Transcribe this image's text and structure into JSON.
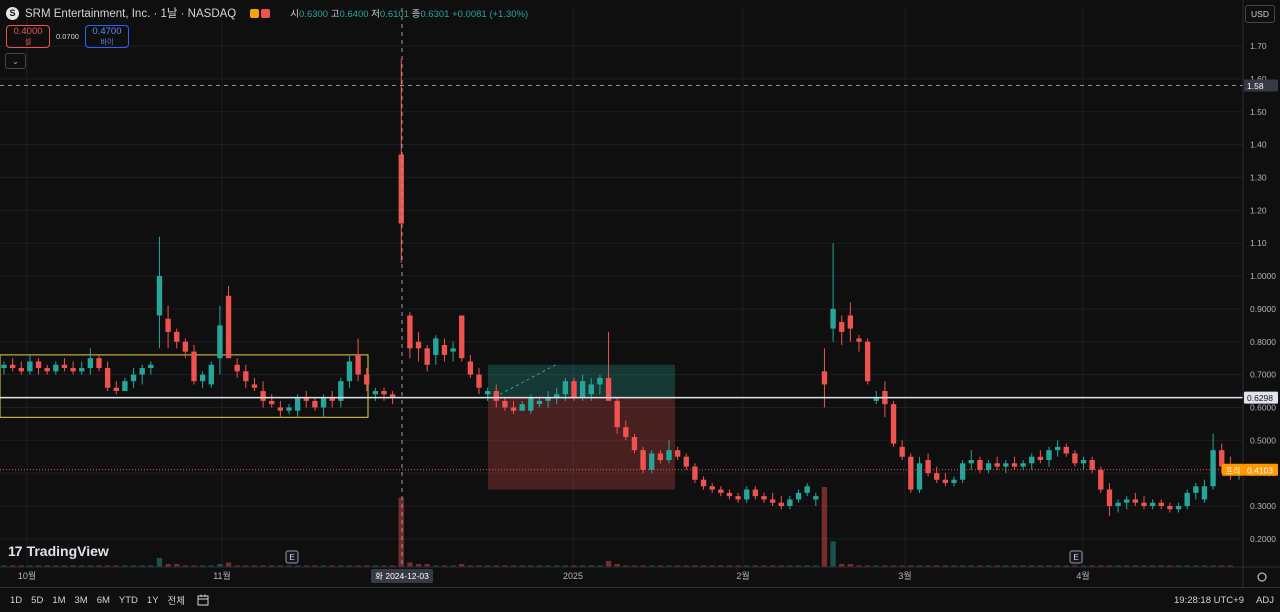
{
  "legend": {
    "symbol_title": "SRM Entertainment, Inc. · 1날 · NASDAQ",
    "open_label": "시",
    "open_value": "0.6300",
    "high_label": "고",
    "high_value": "0.6400",
    "low_label": "저",
    "low_value": "0.6101",
    "close_label": "종",
    "close_value": "0.6301",
    "change": "+0.0081 (+1.30%)"
  },
  "trade": {
    "sell_price": "0.4000",
    "sell_label": "셀",
    "spread": "0.0700",
    "buy_price": "0.4700",
    "buy_label": "바이"
  },
  "currency": "USD",
  "branding": "TradingView",
  "earnings_marker": "E",
  "crosshair_date": "화 2024-12-03",
  "price_tags": {
    "crosshair_price": "1.58",
    "last_price": "0.6298",
    "prefix_label": "프리",
    "prefix_price": "0.4103"
  },
  "bottom": {
    "periods": [
      "1D",
      "5D",
      "1M",
      "3M",
      "6M",
      "YTD",
      "1Y",
      "전체"
    ],
    "clock": "19:28:18 UTC+9",
    "adj": "ADJ"
  },
  "colors": {
    "up": "#26a69a",
    "down": "#ef5350",
    "prefix": "#ff9800",
    "box": "#e9d04a"
  },
  "chart_data": {
    "type": "candlestick",
    "y_axis": {
      "ticks": [
        "0.2000",
        "0.3000",
        "0.4000",
        "0.5000",
        "0.6000",
        "0.7000",
        "0.8000",
        "0.9000",
        "1.0000",
        "1.10",
        "1.20",
        "1.30",
        "1.40",
        "1.50",
        "1.60",
        "1.70"
      ],
      "range": [
        0.1,
        1.78
      ]
    },
    "x_axis": {
      "ticks": [
        "10월",
        "11월",
        "2025",
        "2월",
        "3월",
        "4월"
      ]
    },
    "candles": [
      [
        0.72,
        0.74,
        0.7,
        0.73
      ],
      [
        0.73,
        0.75,
        0.71,
        0.72
      ],
      [
        0.72,
        0.74,
        0.7,
        0.71
      ],
      [
        0.71,
        0.76,
        0.7,
        0.74
      ],
      [
        0.74,
        0.75,
        0.7,
        0.72
      ],
      [
        0.72,
        0.73,
        0.7,
        0.71
      ],
      [
        0.71,
        0.74,
        0.7,
        0.73
      ],
      [
        0.73,
        0.75,
        0.71,
        0.72
      ],
      [
        0.72,
        0.74,
        0.7,
        0.71
      ],
      [
        0.71,
        0.74,
        0.7,
        0.72
      ],
      [
        0.72,
        0.78,
        0.7,
        0.75
      ],
      [
        0.75,
        0.76,
        0.71,
        0.72
      ],
      [
        0.72,
        0.74,
        0.65,
        0.66
      ],
      [
        0.66,
        0.68,
        0.64,
        0.65
      ],
      [
        0.65,
        0.69,
        0.65,
        0.68
      ],
      [
        0.68,
        0.72,
        0.66,
        0.7
      ],
      [
        0.7,
        0.73,
        0.67,
        0.72
      ],
      [
        0.72,
        0.74,
        0.7,
        0.73
      ],
      [
        0.88,
        1.12,
        0.78,
        1.0
      ],
      [
        0.87,
        0.91,
        0.78,
        0.83
      ],
      [
        0.83,
        0.84,
        0.78,
        0.8
      ],
      [
        0.8,
        0.81,
        0.75,
        0.77
      ],
      [
        0.77,
        0.79,
        0.67,
        0.68
      ],
      [
        0.68,
        0.71,
        0.66,
        0.7
      ],
      [
        0.67,
        0.74,
        0.66,
        0.73
      ],
      [
        0.75,
        0.91,
        0.7,
        0.85
      ],
      [
        0.94,
        0.97,
        0.75,
        0.75
      ],
      [
        0.73,
        0.75,
        0.69,
        0.71
      ],
      [
        0.71,
        0.73,
        0.66,
        0.68
      ],
      [
        0.67,
        0.69,
        0.65,
        0.66
      ],
      [
        0.65,
        0.68,
        0.6,
        0.62
      ],
      [
        0.62,
        0.64,
        0.6,
        0.61
      ],
      [
        0.6,
        0.62,
        0.57,
        0.59
      ],
      [
        0.59,
        0.61,
        0.58,
        0.6
      ],
      [
        0.59,
        0.64,
        0.57,
        0.63
      ],
      [
        0.63,
        0.65,
        0.6,
        0.62
      ],
      [
        0.62,
        0.63,
        0.59,
        0.6
      ],
      [
        0.6,
        0.64,
        0.57,
        0.63
      ],
      [
        0.63,
        0.65,
        0.6,
        0.62
      ],
      [
        0.62,
        0.69,
        0.6,
        0.68
      ],
      [
        0.68,
        0.76,
        0.66,
        0.74
      ],
      [
        0.76,
        0.81,
        0.68,
        0.7
      ],
      [
        0.7,
        0.72,
        0.65,
        0.67
      ],
      [
        0.64,
        0.66,
        0.62,
        0.65
      ],
      [
        0.65,
        0.66,
        0.62,
        0.64
      ],
      [
        0.64,
        0.65,
        0.61,
        0.63
      ],
      [
        1.37,
        1.66,
        1.04,
        1.16
      ],
      [
        0.88,
        0.89,
        0.75,
        0.78
      ],
      [
        0.8,
        0.83,
        0.74,
        0.78
      ],
      [
        0.78,
        0.79,
        0.71,
        0.73
      ],
      [
        0.76,
        0.82,
        0.73,
        0.81
      ],
      [
        0.79,
        0.81,
        0.74,
        0.76
      ],
      [
        0.77,
        0.8,
        0.74,
        0.78
      ],
      [
        0.88,
        0.88,
        0.74,
        0.75
      ],
      [
        0.74,
        0.76,
        0.69,
        0.7
      ],
      [
        0.7,
        0.72,
        0.64,
        0.66
      ],
      [
        0.64,
        0.66,
        0.62,
        0.65
      ],
      [
        0.65,
        0.67,
        0.6,
        0.62
      ],
      [
        0.62,
        0.63,
        0.59,
        0.6
      ],
      [
        0.6,
        0.62,
        0.58,
        0.59
      ],
      [
        0.59,
        0.62,
        0.59,
        0.61
      ],
      [
        0.59,
        0.64,
        0.58,
        0.63
      ],
      [
        0.61,
        0.63,
        0.6,
        0.62
      ],
      [
        0.62,
        0.65,
        0.6,
        0.63
      ],
      [
        0.63,
        0.66,
        0.61,
        0.64
      ],
      [
        0.64,
        0.69,
        0.62,
        0.68
      ],
      [
        0.68,
        0.69,
        0.62,
        0.63
      ],
      [
        0.63,
        0.7,
        0.62,
        0.68
      ],
      [
        0.64,
        0.69,
        0.62,
        0.67
      ],
      [
        0.67,
        0.7,
        0.64,
        0.69
      ],
      [
        0.69,
        0.83,
        0.64,
        0.62
      ],
      [
        0.62,
        0.63,
        0.52,
        0.54
      ],
      [
        0.54,
        0.56,
        0.5,
        0.51
      ],
      [
        0.51,
        0.52,
        0.46,
        0.47
      ],
      [
        0.47,
        0.48,
        0.4,
        0.41
      ],
      [
        0.41,
        0.47,
        0.4,
        0.46
      ],
      [
        0.46,
        0.47,
        0.43,
        0.44
      ],
      [
        0.44,
        0.5,
        0.43,
        0.47
      ],
      [
        0.47,
        0.48,
        0.44,
        0.45
      ],
      [
        0.45,
        0.46,
        0.41,
        0.42
      ],
      [
        0.42,
        0.43,
        0.37,
        0.38
      ],
      [
        0.38,
        0.39,
        0.35,
        0.36
      ],
      [
        0.36,
        0.37,
        0.34,
        0.35
      ],
      [
        0.35,
        0.36,
        0.33,
        0.34
      ],
      [
        0.34,
        0.35,
        0.32,
        0.33
      ],
      [
        0.33,
        0.34,
        0.31,
        0.32
      ],
      [
        0.32,
        0.36,
        0.31,
        0.35
      ],
      [
        0.35,
        0.36,
        0.32,
        0.33
      ],
      [
        0.33,
        0.34,
        0.31,
        0.32
      ],
      [
        0.32,
        0.34,
        0.3,
        0.31
      ],
      [
        0.31,
        0.33,
        0.29,
        0.3
      ],
      [
        0.3,
        0.33,
        0.29,
        0.32
      ],
      [
        0.32,
        0.35,
        0.31,
        0.34
      ],
      [
        0.34,
        0.37,
        0.33,
        0.36
      ],
      [
        0.32,
        0.34,
        0.3,
        0.33
      ],
      [
        0.71,
        0.78,
        0.6,
        0.67
      ],
      [
        0.84,
        1.1,
        0.8,
        0.9
      ],
      [
        0.86,
        0.88,
        0.79,
        0.83
      ],
      [
        0.88,
        0.92,
        0.8,
        0.84
      ],
      [
        0.81,
        0.82,
        0.77,
        0.8
      ],
      [
        0.8,
        0.81,
        0.67,
        0.68
      ],
      [
        0.62,
        0.65,
        0.61,
        0.63
      ],
      [
        0.65,
        0.68,
        0.57,
        0.61
      ],
      [
        0.61,
        0.62,
        0.48,
        0.49
      ],
      [
        0.48,
        0.5,
        0.44,
        0.45
      ],
      [
        0.45,
        0.46,
        0.34,
        0.35
      ],
      [
        0.35,
        0.45,
        0.34,
        0.43
      ],
      [
        0.44,
        0.46,
        0.39,
        0.4
      ],
      [
        0.4,
        0.42,
        0.37,
        0.38
      ],
      [
        0.38,
        0.4,
        0.36,
        0.37
      ],
      [
        0.37,
        0.39,
        0.36,
        0.38
      ],
      [
        0.38,
        0.44,
        0.37,
        0.43
      ],
      [
        0.43,
        0.47,
        0.41,
        0.44
      ],
      [
        0.44,
        0.45,
        0.4,
        0.41
      ],
      [
        0.41,
        0.44,
        0.4,
        0.43
      ],
      [
        0.43,
        0.45,
        0.41,
        0.42
      ],
      [
        0.42,
        0.44,
        0.4,
        0.43
      ],
      [
        0.43,
        0.45,
        0.41,
        0.42
      ],
      [
        0.42,
        0.44,
        0.41,
        0.43
      ],
      [
        0.43,
        0.46,
        0.41,
        0.45
      ],
      [
        0.45,
        0.47,
        0.43,
        0.44
      ],
      [
        0.44,
        0.48,
        0.42,
        0.47
      ],
      [
        0.47,
        0.5,
        0.45,
        0.48
      ],
      [
        0.48,
        0.49,
        0.45,
        0.46
      ],
      [
        0.46,
        0.47,
        0.42,
        0.43
      ],
      [
        0.43,
        0.45,
        0.41,
        0.44
      ],
      [
        0.44,
        0.45,
        0.4,
        0.41
      ],
      [
        0.41,
        0.42,
        0.34,
        0.35
      ],
      [
        0.35,
        0.37,
        0.27,
        0.3
      ],
      [
        0.3,
        0.32,
        0.28,
        0.31
      ],
      [
        0.31,
        0.33,
        0.29,
        0.32
      ],
      [
        0.32,
        0.34,
        0.3,
        0.31
      ],
      [
        0.31,
        0.33,
        0.29,
        0.3
      ],
      [
        0.3,
        0.32,
        0.29,
        0.31
      ],
      [
        0.31,
        0.32,
        0.29,
        0.3
      ],
      [
        0.3,
        0.31,
        0.28,
        0.29
      ],
      [
        0.29,
        0.31,
        0.28,
        0.3
      ],
      [
        0.3,
        0.35,
        0.29,
        0.34
      ],
      [
        0.34,
        0.37,
        0.32,
        0.36
      ],
      [
        0.32,
        0.38,
        0.31,
        0.36
      ],
      [
        0.36,
        0.52,
        0.35,
        0.47
      ],
      [
        0.47,
        0.49,
        0.4,
        0.42
      ],
      [
        0.42,
        0.45,
        0.38,
        0.4
      ],
      [
        0.4,
        0.42,
        0.38,
        0.41
      ]
    ],
    "volume": [
      0.01,
      0.01,
      0.01,
      0.01,
      0.01,
      0.01,
      0.01,
      0.01,
      0.01,
      0.01,
      0.01,
      0.01,
      0.01,
      0.01,
      0.01,
      0.01,
      0.01,
      0.01,
      0.06,
      0.02,
      0.02,
      0.01,
      0.01,
      0.01,
      0.01,
      0.02,
      0.03,
      0.01,
      0.01,
      0.01,
      0.01,
      0.01,
      0.01,
      0.01,
      0.01,
      0.01,
      0.01,
      0.01,
      0.01,
      0.01,
      0.01,
      0.01,
      0.01,
      0.01,
      0.01,
      0.01,
      0.46,
      0.03,
      0.02,
      0.02,
      0.01,
      0.01,
      0.01,
      0.02,
      0.01,
      0.01,
      0.01,
      0.01,
      0.01,
      0.01,
      0.01,
      0.01,
      0.01,
      0.01,
      0.01,
      0.01,
      0.01,
      0.01,
      0.01,
      0.01,
      0.04,
      0.02,
      0.01,
      0.01,
      0.01,
      0.01,
      0.01,
      0.01,
      0.01,
      0.01,
      0.01,
      0.01,
      0.01,
      0.01,
      0.01,
      0.01,
      0.01,
      0.01,
      0.01,
      0.01,
      0.01,
      0.01,
      0.01,
      0.01,
      0.01,
      0.53,
      0.17,
      0.02,
      0.02,
      0.01,
      0.01,
      0.01,
      0.01,
      0.01,
      0.01,
      0.01,
      0.01,
      0.01,
      0.01,
      0.01,
      0.01,
      0.01,
      0.01,
      0.01,
      0.01,
      0.01,
      0.01,
      0.01,
      0.01,
      0.01,
      0.01,
      0.01,
      0.01,
      0.01,
      0.01,
      0.01,
      0.01,
      0.01,
      0.01,
      0.01,
      0.01,
      0.01,
      0.01,
      0.01,
      0.01,
      0.01,
      0.01,
      0.01,
      0.01,
      0.01,
      0.01,
      0.01,
      0.01
    ],
    "annotations": {
      "range_box_price": [
        0.57,
        0.76
      ],
      "long_position": {
        "target": 0.73,
        "entry": 0.63,
        "stop": 0.35
      },
      "horizontal_line": 0.6298,
      "prefix_line": 0.4103
    }
  }
}
